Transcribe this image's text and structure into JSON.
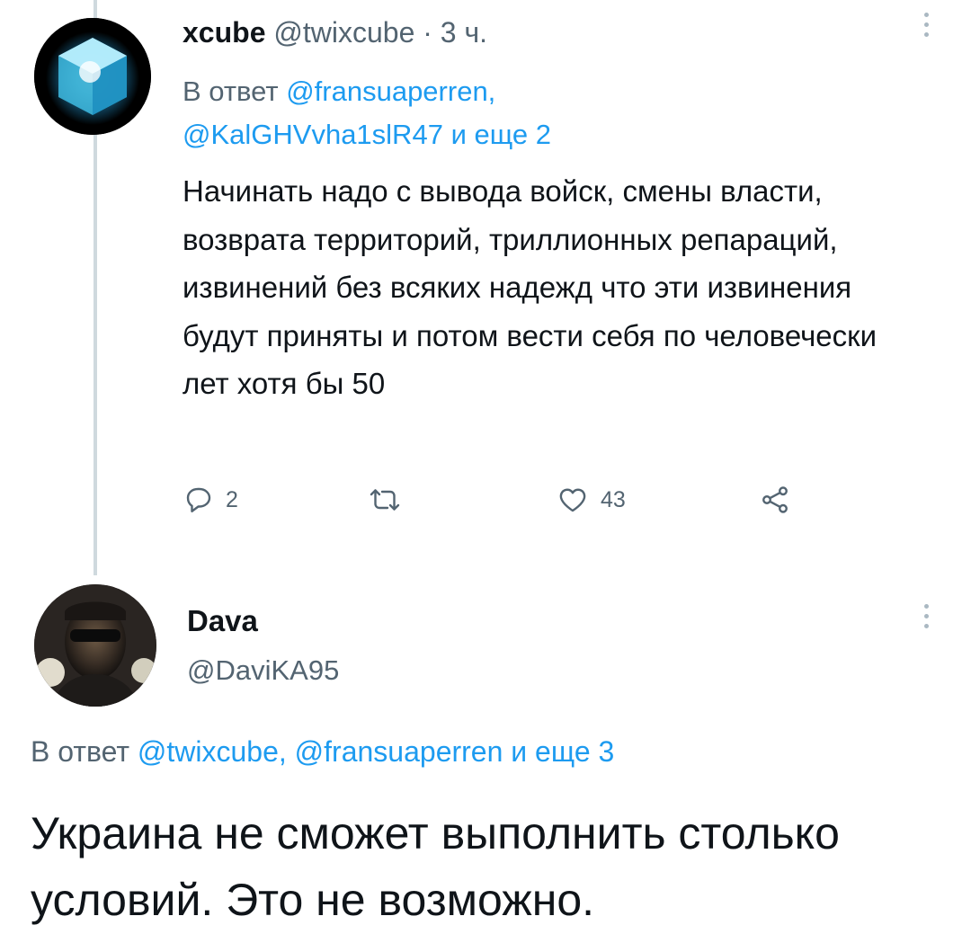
{
  "tweet1": {
    "display_name": "xcube",
    "handle": "@twixcube",
    "separator": "·",
    "time": "3 ч.",
    "reply_prefix": "В ответ",
    "reply_to_1": "@fransuaperren,",
    "reply_to_2": "@KalGHVvha1slR47",
    "reply_suffix": "и еще 2",
    "body": "Начинать надо с вывода войск, смены власти, возврата территорий, триллионных репараций, извинений без всяких надежд что эти извинения будут приняты и потом вести себя по человечески лет хотя бы 50",
    "replies_count": "2",
    "retweets_count": "",
    "likes_count": "43"
  },
  "tweet2": {
    "display_name": "Dava",
    "handle": "@DaviKA95",
    "reply_prefix": "В ответ",
    "reply_to": "@twixcube, @fransuaperren",
    "reply_suffix": "и еще 3",
    "body": "Украина не сможет выполнить столько условий. Это не возможно."
  },
  "icons": {
    "reply": "speech-bubble-icon",
    "retweet": "retweet-icon",
    "like": "heart-icon",
    "share": "share-icon",
    "more": "vertical-ellipsis-icon"
  },
  "colors": {
    "link": "#1d9bf0",
    "muted": "#536471",
    "text": "#0f1419",
    "thread_line": "#cfd9de"
  }
}
